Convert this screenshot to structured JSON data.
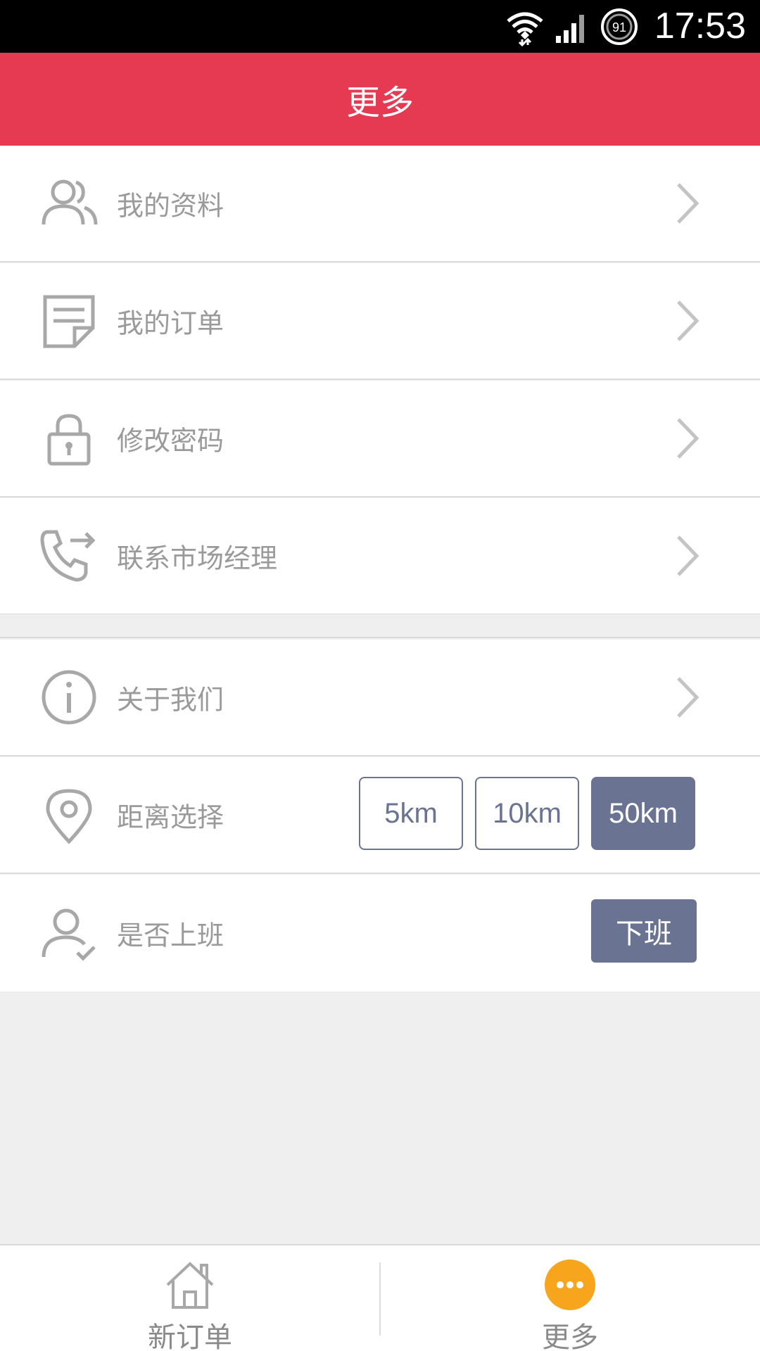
{
  "status_bar": {
    "time": "17:53",
    "battery_level": "91"
  },
  "header": {
    "title": "更多"
  },
  "menu": {
    "items": [
      {
        "label": "我的资料",
        "icon": "users-icon"
      },
      {
        "label": "我的订单",
        "icon": "order-icon"
      },
      {
        "label": "修改密码",
        "icon": "lock-icon"
      },
      {
        "label": "联系市场经理",
        "icon": "phone-transfer-icon"
      }
    ],
    "about": {
      "label": "关于我们",
      "icon": "info-icon"
    },
    "distance": {
      "label": "距离选择",
      "icon": "location-pin-icon",
      "options": [
        "5km",
        "10km",
        "50km"
      ],
      "selected": "50km"
    },
    "work": {
      "label": "是否上班",
      "icon": "user-check-icon",
      "button": "下班"
    }
  },
  "bottom_nav": {
    "items": [
      {
        "label": "新订单",
        "icon": "home-icon"
      },
      {
        "label": "更多",
        "icon": "more-icon"
      }
    ],
    "active_color": "#f7a51c"
  },
  "colors": {
    "header": "#e63a53",
    "accent": "#6a7492"
  }
}
